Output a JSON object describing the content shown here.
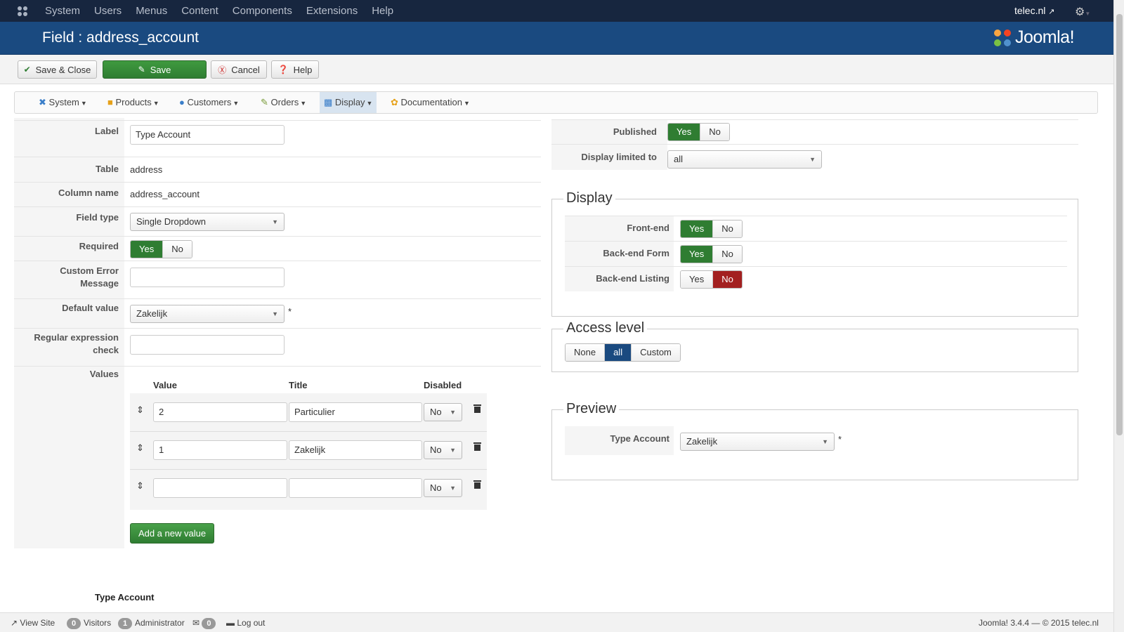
{
  "topnav": {
    "items": [
      "System",
      "Users",
      "Menus",
      "Content",
      "Components",
      "Extensions",
      "Help"
    ],
    "site_link": "telec.nl",
    "external_icon": "external-link-icon",
    "gear_icon": "gear-icon"
  },
  "header": {
    "title": "Field : address_account",
    "brand": "Joomla!"
  },
  "toolbar": {
    "save_close": "Save & Close",
    "save": "Save",
    "cancel": "Cancel",
    "help": "Help"
  },
  "submenu": {
    "items": [
      {
        "label": "System",
        "icon": "tools-icon"
      },
      {
        "label": "Products",
        "icon": "folder-icon"
      },
      {
        "label": "Customers",
        "icon": "users-icon"
      },
      {
        "label": "Orders",
        "icon": "orders-icon"
      },
      {
        "label": "Display",
        "icon": "display-icon"
      },
      {
        "label": "Documentation",
        "icon": "documentation-icon"
      }
    ]
  },
  "form": {
    "label_label": "Label",
    "label_value": "Type Account",
    "table_label": "Table",
    "table_value": "address",
    "column_label": "Column name",
    "column_value": "address_account",
    "fieldtype_label": "Field type",
    "fieldtype_value": "Single Dropdown",
    "required_label": "Required",
    "required_yes": "Yes",
    "required_no": "No",
    "custom_error_label_1": "Custom Error",
    "custom_error_label_2": "Message",
    "custom_error_value": "",
    "default_label": "Default value",
    "default_value": "Zakelijk",
    "asterisk": "*",
    "regex_label_1": "Regular expression",
    "regex_label_2": "check",
    "regex_value": "",
    "values_label": "Values",
    "values_headers": {
      "value": "Value",
      "title": "Title",
      "disabled": "Disabled"
    },
    "values_rows": [
      {
        "value": "2",
        "title": "Particulier",
        "disabled": "No"
      },
      {
        "value": "1",
        "title": "Zakelijk",
        "disabled": "No"
      },
      {
        "value": "",
        "title": "",
        "disabled": "No"
      }
    ],
    "add_value": "Add a new value",
    "bottom_label": "Type Account"
  },
  "right": {
    "published_label": "Published",
    "published_yes": "Yes",
    "published_no": "No",
    "display_limited_label": "Display limited to",
    "display_limited_value": "all",
    "display_legend": "Display",
    "frontend_label": "Front-end",
    "backend_form_label": "Back-end Form",
    "backend_listing_label": "Back-end Listing",
    "yes": "Yes",
    "no": "No",
    "access_legend": "Access level",
    "access_none": "None",
    "access_all": "all",
    "access_custom": "Custom",
    "preview_legend": "Preview",
    "preview_label": "Type Account",
    "preview_value": "Zakelijk",
    "asterisk": "*"
  },
  "footer": {
    "view_site": "View Site",
    "visitors_count": "0",
    "visitors": "Visitors",
    "admin_count": "1",
    "administrator": "Administrator",
    "messages_count": "0",
    "logout": "Log out",
    "version": "Joomla! 3.4.4  —  © 2015 telec.nl"
  },
  "colors": {
    "navbar": "#17263f",
    "header": "#1a4a80",
    "success": "#2f7d32",
    "danger": "#a32020"
  }
}
